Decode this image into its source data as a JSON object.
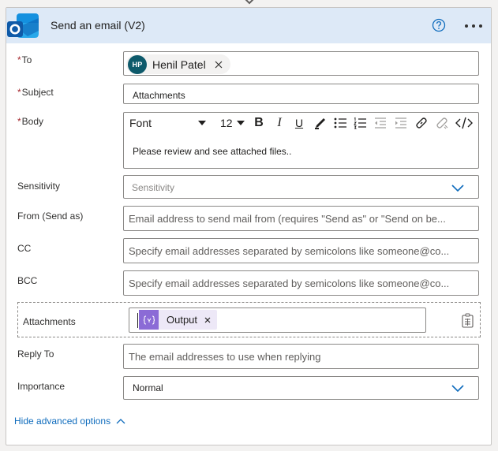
{
  "action": {
    "title": "Send an email (V2)",
    "app_icon": "outlook-icon",
    "help_icon": "help-circle-icon",
    "more_icon": "more-options-icon"
  },
  "fields": {
    "to": {
      "required_mark": "*",
      "label": "To",
      "recipient": {
        "initials": "HP",
        "name": "Henil Patel",
        "avatar_color": "#0e5a6b"
      }
    },
    "subject": {
      "required_mark": "*",
      "label": "Subject",
      "value": "Attachments"
    },
    "body": {
      "required_mark": "*",
      "label": "Body",
      "toolbar": {
        "font": "Font",
        "font_size": "12"
      },
      "value": "Please review and see attached files.."
    },
    "sensitivity": {
      "label": "Sensitivity",
      "placeholder": "Sensitivity"
    },
    "from": {
      "label": "From (Send as)",
      "placeholder": "Email address to send mail from (requires \"Send as\" or \"Send on be..."
    },
    "cc": {
      "label": "CC",
      "placeholder": "Specify email addresses separated by semicolons like someone@co..."
    },
    "bcc": {
      "label": "BCC",
      "placeholder": "Specify email addresses separated by semicolons like someone@co..."
    },
    "attachments": {
      "label": "Attachments",
      "token": "Output",
      "token_color": "#8b6bd6"
    },
    "reply_to": {
      "label": "Reply To",
      "placeholder": "The email addresses to use when replying"
    },
    "importance": {
      "label": "Importance",
      "value": "Normal"
    }
  },
  "advanced": {
    "label": "Hide advanced options"
  },
  "colors": {
    "header_bg": "#dde9f7",
    "accent": "#0f6cbd",
    "required": "#a4262c"
  }
}
